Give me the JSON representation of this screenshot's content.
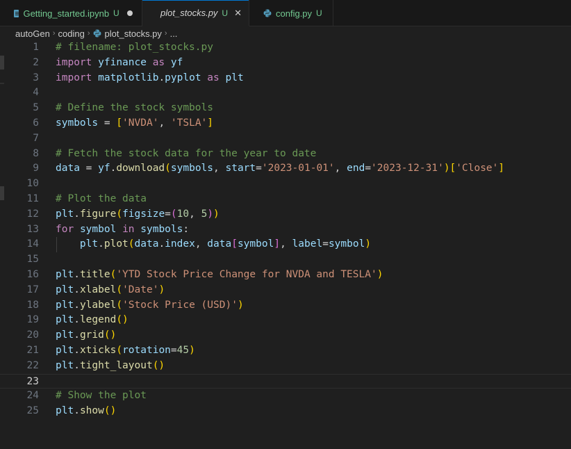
{
  "tabs": [
    {
      "name": "Getting_started.ipynb",
      "status": "U",
      "icon": "notebook-icon",
      "tail": "unsaved-dot"
    },
    {
      "name": "plot_stocks.py",
      "status": "U",
      "icon": "python-icon",
      "tail": "close",
      "close_glyph": "✕"
    },
    {
      "name": "config.py",
      "status": "U",
      "icon": "python-icon"
    }
  ],
  "breadcrumb": {
    "items": [
      "autoGen",
      "coding",
      "plot_stocks.py",
      "..."
    ],
    "separator": "›"
  },
  "editor": {
    "current_line": 23,
    "line_numbers": [
      "1",
      "2",
      "3",
      "4",
      "5",
      "6",
      "7",
      "8",
      "9",
      "10",
      "11",
      "12",
      "13",
      "14",
      "15",
      "16",
      "17",
      "18",
      "19",
      "20",
      "21",
      "22",
      "23",
      "24",
      "25"
    ],
    "lines": [
      [
        [
          "com",
          "# filename: plot_stocks.py"
        ]
      ],
      [
        [
          "kw",
          "import"
        ],
        [
          "op",
          " "
        ],
        [
          "var",
          "yfinance"
        ],
        [
          "op",
          " "
        ],
        [
          "kw",
          "as"
        ],
        [
          "op",
          " "
        ],
        [
          "var",
          "yf"
        ]
      ],
      [
        [
          "kw",
          "import"
        ],
        [
          "op",
          " "
        ],
        [
          "var",
          "matplotlib"
        ],
        [
          "op",
          "."
        ],
        [
          "var",
          "pyplot"
        ],
        [
          "op",
          " "
        ],
        [
          "kw",
          "as"
        ],
        [
          "op",
          " "
        ],
        [
          "var",
          "plt"
        ]
      ],
      [],
      [
        [
          "com",
          "# Define the stock symbols"
        ]
      ],
      [
        [
          "var",
          "symbols"
        ],
        [
          "op",
          " = "
        ],
        [
          "b1",
          "["
        ],
        [
          "str",
          "'NVDA'"
        ],
        [
          "punc",
          ", "
        ],
        [
          "str",
          "'TSLA'"
        ],
        [
          "b1",
          "]"
        ]
      ],
      [],
      [
        [
          "com",
          "# Fetch the stock data for the year to date"
        ]
      ],
      [
        [
          "var",
          "data"
        ],
        [
          "op",
          " = "
        ],
        [
          "var",
          "yf"
        ],
        [
          "op",
          "."
        ],
        [
          "fn",
          "download"
        ],
        [
          "b1",
          "("
        ],
        [
          "var",
          "symbols"
        ],
        [
          "punc",
          ", "
        ],
        [
          "var",
          "start"
        ],
        [
          "op",
          "="
        ],
        [
          "str",
          "'2023-01-01'"
        ],
        [
          "punc",
          ", "
        ],
        [
          "var",
          "end"
        ],
        [
          "op",
          "="
        ],
        [
          "str",
          "'2023-12-31'"
        ],
        [
          "b1",
          ")"
        ],
        [
          "b1",
          "["
        ],
        [
          "str",
          "'Close'"
        ],
        [
          "b1",
          "]"
        ]
      ],
      [],
      [
        [
          "com",
          "# Plot the data"
        ]
      ],
      [
        [
          "var",
          "plt"
        ],
        [
          "op",
          "."
        ],
        [
          "fn",
          "figure"
        ],
        [
          "b1",
          "("
        ],
        [
          "var",
          "figsize"
        ],
        [
          "op",
          "="
        ],
        [
          "b2",
          "("
        ],
        [
          "num",
          "10"
        ],
        [
          "punc",
          ", "
        ],
        [
          "num",
          "5"
        ],
        [
          "b2",
          ")"
        ],
        [
          "b1",
          ")"
        ]
      ],
      [
        [
          "kw",
          "for"
        ],
        [
          "op",
          " "
        ],
        [
          "var",
          "symbol"
        ],
        [
          "op",
          " "
        ],
        [
          "kw",
          "in"
        ],
        [
          "op",
          " "
        ],
        [
          "var",
          "symbols"
        ],
        [
          "op",
          ":"
        ]
      ],
      [
        [
          "op",
          "    "
        ],
        [
          "var",
          "plt"
        ],
        [
          "op",
          "."
        ],
        [
          "fn",
          "plot"
        ],
        [
          "b1",
          "("
        ],
        [
          "var",
          "data"
        ],
        [
          "op",
          "."
        ],
        [
          "var",
          "index"
        ],
        [
          "punc",
          ", "
        ],
        [
          "var",
          "data"
        ],
        [
          "b2",
          "["
        ],
        [
          "var",
          "symbol"
        ],
        [
          "b2",
          "]"
        ],
        [
          "punc",
          ", "
        ],
        [
          "var",
          "label"
        ],
        [
          "op",
          "="
        ],
        [
          "var",
          "symbol"
        ],
        [
          "b1",
          ")"
        ]
      ],
      [],
      [
        [
          "var",
          "plt"
        ],
        [
          "op",
          "."
        ],
        [
          "fn",
          "title"
        ],
        [
          "b1",
          "("
        ],
        [
          "str",
          "'YTD Stock Price Change for NVDA and TESLA'"
        ],
        [
          "b1",
          ")"
        ]
      ],
      [
        [
          "var",
          "plt"
        ],
        [
          "op",
          "."
        ],
        [
          "fn",
          "xlabel"
        ],
        [
          "b1",
          "("
        ],
        [
          "str",
          "'Date'"
        ],
        [
          "b1",
          ")"
        ]
      ],
      [
        [
          "var",
          "plt"
        ],
        [
          "op",
          "."
        ],
        [
          "fn",
          "ylabel"
        ],
        [
          "b1",
          "("
        ],
        [
          "str",
          "'Stock Price (USD)'"
        ],
        [
          "b1",
          ")"
        ]
      ],
      [
        [
          "var",
          "plt"
        ],
        [
          "op",
          "."
        ],
        [
          "fn",
          "legend"
        ],
        [
          "b1",
          "()"
        ]
      ],
      [
        [
          "var",
          "plt"
        ],
        [
          "op",
          "."
        ],
        [
          "fn",
          "grid"
        ],
        [
          "b1",
          "()"
        ]
      ],
      [
        [
          "var",
          "plt"
        ],
        [
          "op",
          "."
        ],
        [
          "fn",
          "xticks"
        ],
        [
          "b1",
          "("
        ],
        [
          "var",
          "rotation"
        ],
        [
          "op",
          "="
        ],
        [
          "num",
          "45"
        ],
        [
          "b1",
          ")"
        ]
      ],
      [
        [
          "var",
          "plt"
        ],
        [
          "op",
          "."
        ],
        [
          "fn",
          "tight_layout"
        ],
        [
          "b1",
          "()"
        ]
      ],
      [],
      [
        [
          "com",
          "# Show the plot"
        ]
      ],
      [
        [
          "var",
          "plt"
        ],
        [
          "op",
          "."
        ],
        [
          "fn",
          "show"
        ],
        [
          "b1",
          "()"
        ]
      ]
    ]
  },
  "colors": {
    "background": "#1f1f1f",
    "tab_active_accent": "#0078d4",
    "git_untracked": "#73c991",
    "comment": "#6a9955",
    "keyword": "#c586c0",
    "variable": "#9cdcfe",
    "function": "#dcdcaa",
    "string": "#ce9178",
    "number": "#b5cea8"
  }
}
